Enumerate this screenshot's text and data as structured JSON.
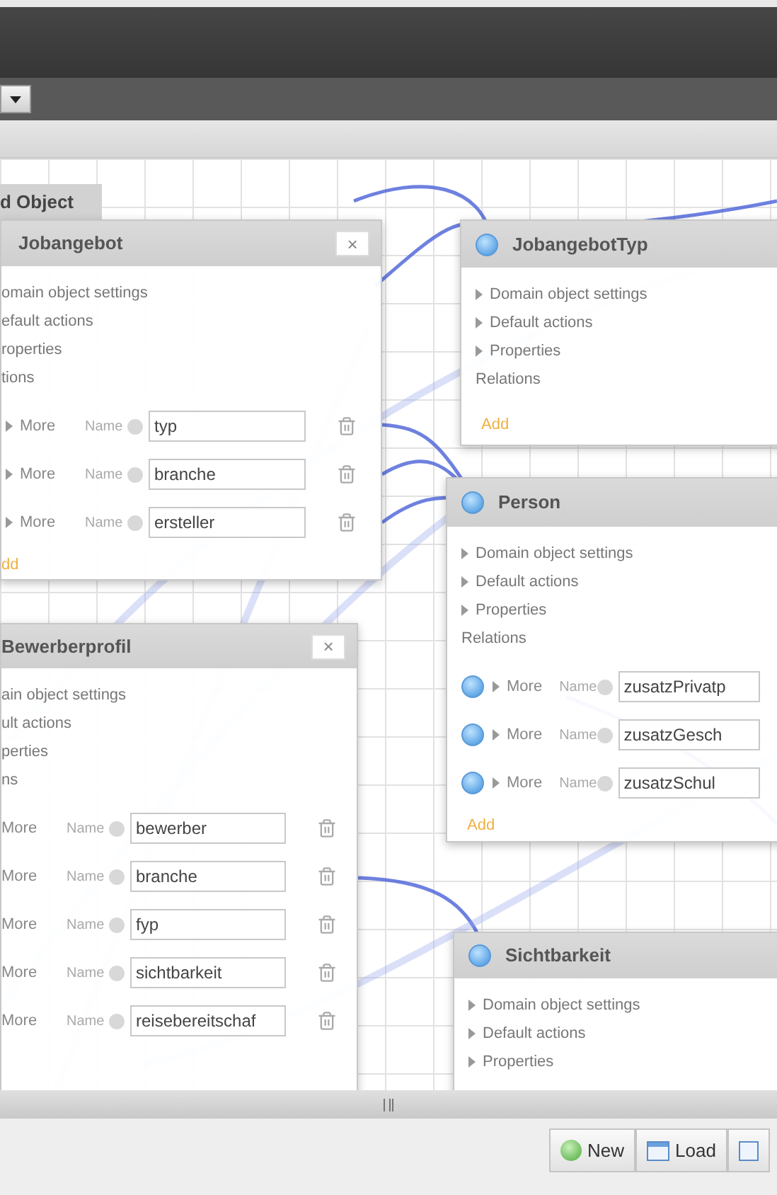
{
  "canvas": {
    "tab": "d Object",
    "nodes": [
      {
        "title": "Jobangebot",
        "anchor": false,
        "close": "×",
        "sections": [
          {
            "label": "omain object settings",
            "arrow": false
          },
          {
            "label": "efault actions",
            "arrow": false
          },
          {
            "label": "roperties",
            "arrow": false
          }
        ],
        "relations_label": "tions",
        "relations": [
          {
            "anchor": false,
            "arrow": true,
            "more": "More",
            "name_label": "Name",
            "value": "typ"
          },
          {
            "anchor": false,
            "arrow": true,
            "more": "More",
            "name_label": "Name",
            "value": "branche"
          },
          {
            "anchor": false,
            "arrow": true,
            "more": "More",
            "name_label": "Name",
            "value": "ersteller"
          }
        ],
        "add": "dd"
      },
      {
        "title": "JobangebotTyp",
        "anchor": true,
        "sections": [
          {
            "label": "Domain object settings",
            "arrow": true
          },
          {
            "label": "Default actions",
            "arrow": true
          },
          {
            "label": "Properties",
            "arrow": true
          }
        ],
        "relations_label": "Relations",
        "add": "Add"
      },
      {
        "title": "Person",
        "anchor": true,
        "sections": [
          {
            "label": "Domain object settings",
            "arrow": true
          },
          {
            "label": "Default actions",
            "arrow": true
          },
          {
            "label": "Properties",
            "arrow": true
          }
        ],
        "relations_label": "Relations",
        "relations": [
          {
            "anchor": true,
            "arrow": true,
            "more": "More",
            "name_label": "Name",
            "value": "zusatzPrivatp"
          },
          {
            "anchor": true,
            "arrow": true,
            "more": "More",
            "name_label": "Name",
            "value": "zusatzGesch"
          },
          {
            "anchor": true,
            "arrow": true,
            "more": "More",
            "name_label": "Name",
            "value": "zusatzSchul"
          }
        ],
        "add": "Add"
      },
      {
        "title": "Bewerberprofil",
        "anchor": false,
        "close": "×",
        "sections": [
          {
            "label": "ain object settings",
            "arrow": false
          },
          {
            "label": "ult actions",
            "arrow": false
          },
          {
            "label": "perties",
            "arrow": false
          }
        ],
        "relations_label": "ns",
        "relations": [
          {
            "anchor": false,
            "arrow": false,
            "more": "More",
            "name_label": "Name",
            "value": "bewerber"
          },
          {
            "anchor": false,
            "arrow": false,
            "more": "More",
            "name_label": "Name",
            "value": "branche"
          },
          {
            "anchor": false,
            "arrow": false,
            "more": "More",
            "name_label": "Name",
            "value": "fyp"
          },
          {
            "anchor": false,
            "arrow": false,
            "more": "More",
            "name_label": "Name",
            "value": "sichtbarkeit"
          },
          {
            "anchor": false,
            "arrow": false,
            "more": "More",
            "name_label": "Name",
            "value": "reisebereitschaf"
          }
        ]
      },
      {
        "title": "Sichtbarkeit",
        "anchor": true,
        "sections": [
          {
            "label": "Domain object settings",
            "arrow": true
          },
          {
            "label": "Default actions",
            "arrow": true
          },
          {
            "label": "Properties",
            "arrow": true
          }
        ]
      }
    ]
  },
  "buttons": [
    {
      "kind": "new",
      "label": "New"
    },
    {
      "kind": "load",
      "label": "Load"
    },
    {
      "kind": "document"
    }
  ]
}
